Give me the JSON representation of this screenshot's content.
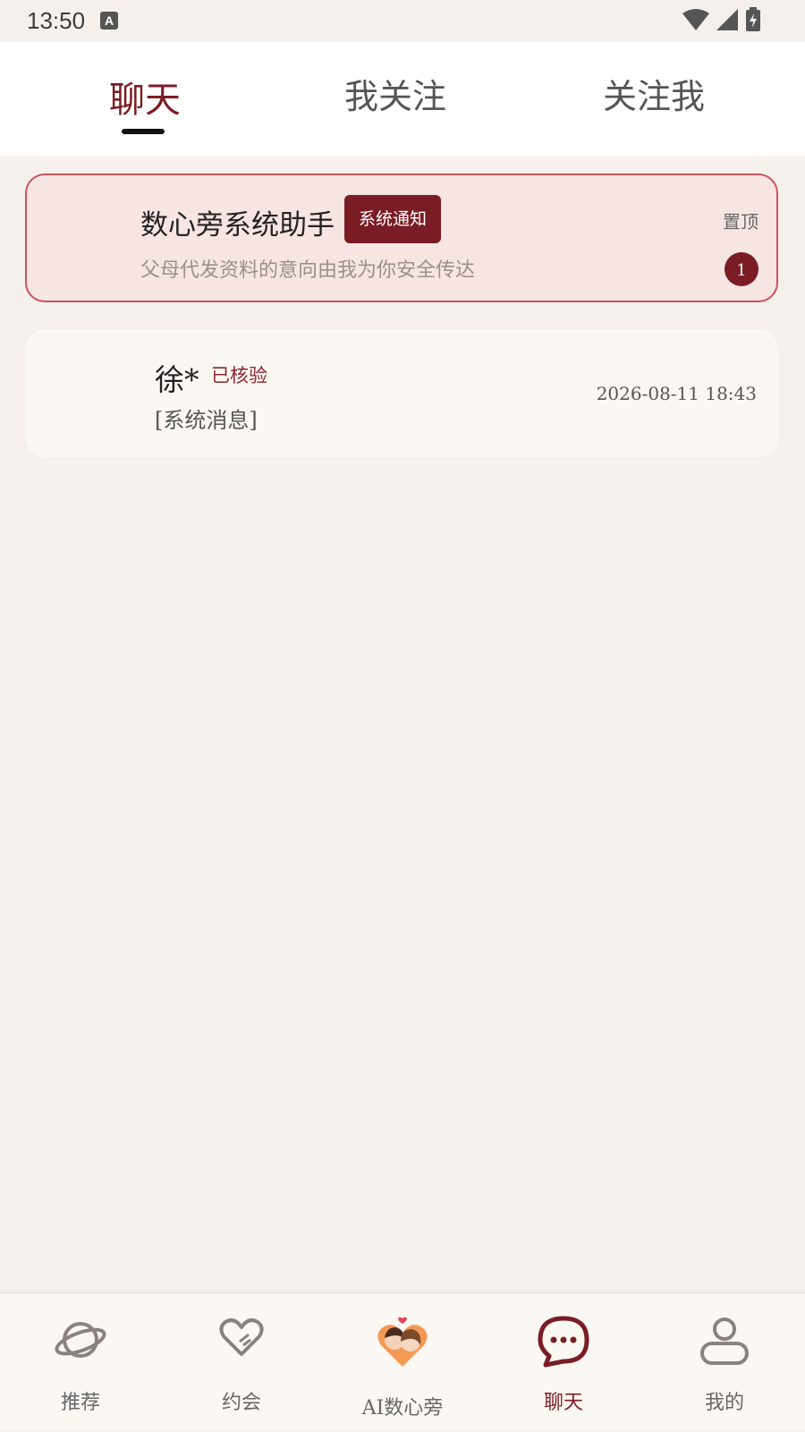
{
  "status_bar": {
    "time": "13:50",
    "a_icon_letter": "A"
  },
  "tabs": [
    {
      "label": "聊天",
      "active": true
    },
    {
      "label": "我关注",
      "active": false
    },
    {
      "label": "关注我",
      "active": false
    }
  ],
  "pinned_chat": {
    "title": "数心旁系统助手",
    "badge": "系统通知",
    "subtitle": "父母代发资料的意向由我为你安全传达",
    "pin_label": "置顶",
    "unread_count": "1"
  },
  "chat_item": {
    "name": "徐*",
    "verified_label": "已核验",
    "last_message": "[系统消息]",
    "timestamp": "2026-08-11 18:43"
  },
  "bottom_nav": [
    {
      "label": "推荐",
      "icon": "planet-icon"
    },
    {
      "label": "约会",
      "icon": "heart-icon"
    },
    {
      "label": "AI数心旁",
      "icon": "couple-icon"
    },
    {
      "label": "聊天",
      "icon": "chat-bubble-icon",
      "active": true
    },
    {
      "label": "我的",
      "icon": "person-icon"
    }
  ],
  "colors": {
    "accent": "#7a1c24",
    "background": "#f5f0ec",
    "pinned_bg": "#f7e5e4",
    "pinned_border": "#c8545f"
  }
}
